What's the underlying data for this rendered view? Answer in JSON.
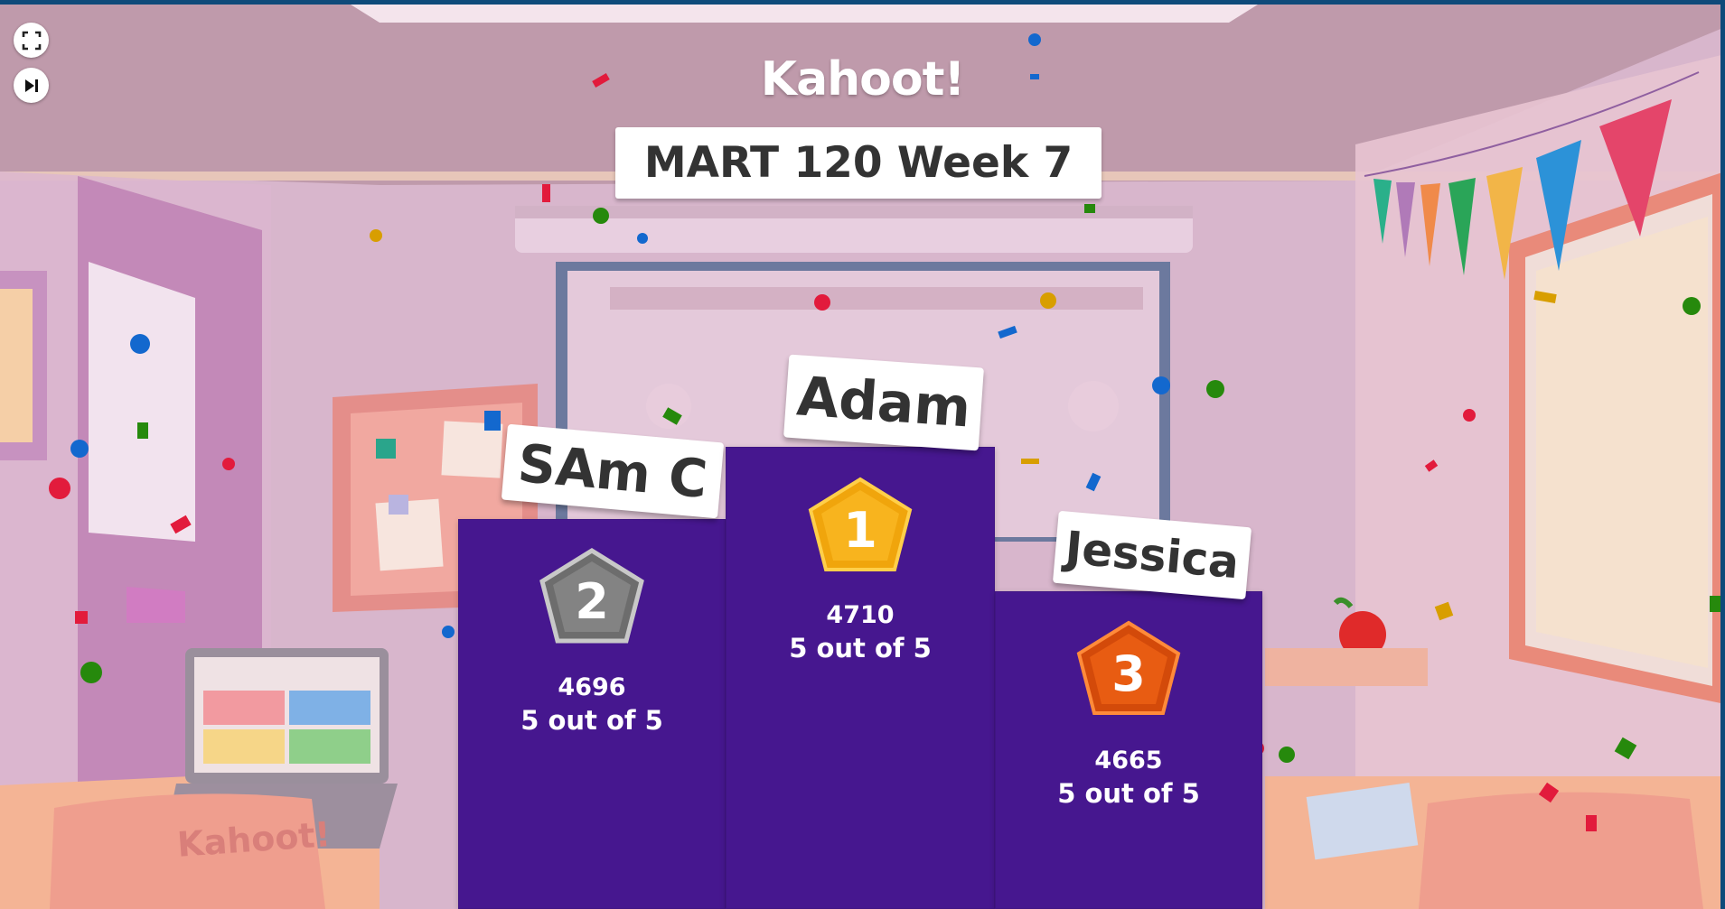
{
  "controls": {
    "fullscreen_icon": "fullscreen-icon",
    "skip_icon": "skip-next-icon"
  },
  "brand": {
    "logo_text": "Kahoot!",
    "laptop_logo": "Kahoot!",
    "chair_logo": "Kahoot!"
  },
  "quiz": {
    "title": "MART 120 Week 7"
  },
  "podium": {
    "first": {
      "rank": "1",
      "name": "Adam",
      "points": "4710",
      "correct": "5 out of 5",
      "medal_color": "#f8b41e"
    },
    "second": {
      "rank": "2",
      "name": "SAm C",
      "points": "4696",
      "correct": "5 out of 5",
      "medal_color": "#808080"
    },
    "third": {
      "rank": "3",
      "name": "Jessica",
      "points": "4665",
      "correct": "5 out of 5",
      "medal_color": "#e85c12"
    }
  },
  "colors": {
    "pillar": "#46178f",
    "wall": "#d9b4c9",
    "frame_border": "#0e4a7a"
  }
}
